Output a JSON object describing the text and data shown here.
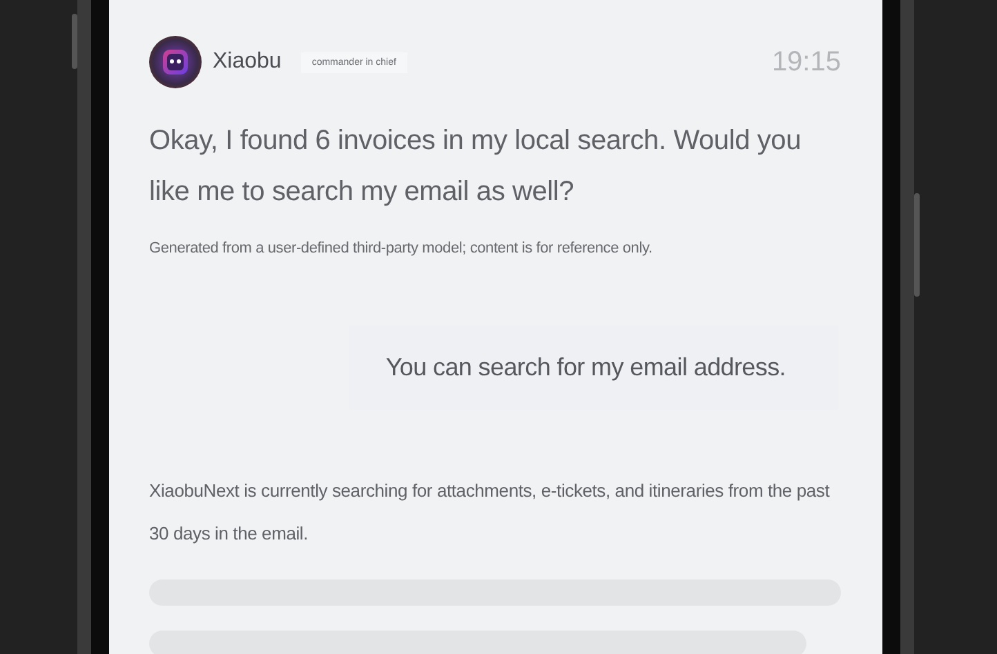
{
  "header": {
    "name": "Xiaobu",
    "tag": "commander in chief",
    "time": "19:15"
  },
  "messages": [
    {
      "kind": "assistant",
      "text": "Okay, I found 6 invoices in my local search. Would you like me to search my email as well?"
    },
    {
      "kind": "note",
      "text": "Generated from a user-defined third-party model; content is for reference only."
    },
    {
      "kind": "user",
      "text": "You can search for my email address."
    },
    {
      "kind": "status",
      "text": "XiaobuNext is currently searching for attachments, e-tickets, and itineraries from the past 30 days in the email."
    }
  ]
}
